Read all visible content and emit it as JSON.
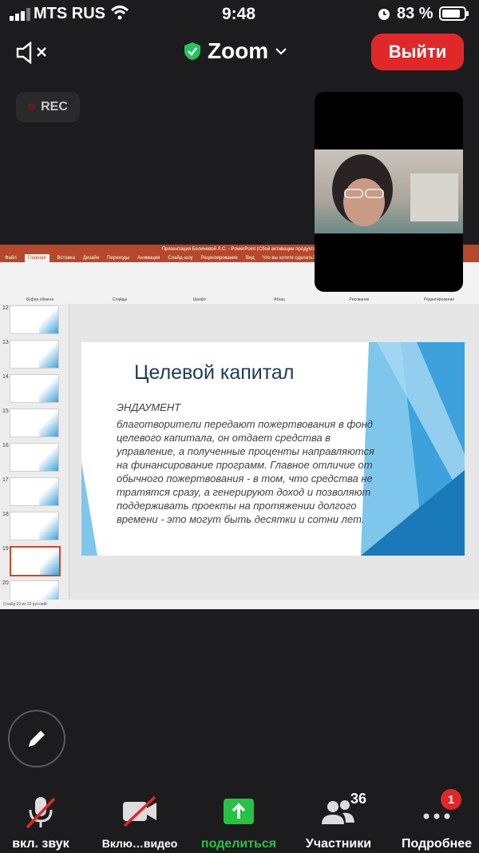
{
  "status": {
    "carrier": "MTS RUS",
    "time": "9:48",
    "battery": "83 %"
  },
  "header": {
    "title": "Zoom",
    "leave_label": "Выйти"
  },
  "rec_label": "REC",
  "ppt": {
    "window_title": "Презентация Беличевой Л.С. - PowerPoint (Сбой активации продукта)",
    "tabs": [
      "Файл",
      "Главная",
      "Вставка",
      "Дизайн",
      "Переходы",
      "Анимация",
      "Слайд-шоу",
      "Рецензирование",
      "Вид"
    ],
    "search_hint": "Что вы хотите сделать?",
    "ribbon_groups": [
      "Буфер обмена",
      "Слайды",
      "Шрифт",
      "Абзац",
      "Рисование",
      "Редактирование"
    ],
    "thumbnails": [
      "12",
      "13",
      "14",
      "15",
      "16",
      "17",
      "18",
      "19",
      "20"
    ],
    "statusbar": "Слайд 19 из 23     русский"
  },
  "slide": {
    "title": "Целевой капитал",
    "subtitle": "ЭНДАУМЕНТ",
    "body": "благотворители передают пожертвования в фонд целевого капитала, он отдает средства в управление, а полученные проценты направляются на финансирование программ. Главное отличие от обычного пожертвования - в том, что средства не тратятся сразу, а генерируют доход и позволяют поддерживать проекты на протяжении долгого времени - это могут быть десятки и сотни лет."
  },
  "toolbar": {
    "mute_label": "вкл. звук",
    "video_label": "Вклю…видео",
    "share_label": "поделиться",
    "participants_label": "Участники",
    "participants_count": "36",
    "more_label": "Подробнее",
    "more_badge": "1"
  },
  "colors": {
    "leave": "#e02828",
    "share": "#26c243",
    "shield": "#22c55e",
    "ppt": "#b7472a"
  }
}
